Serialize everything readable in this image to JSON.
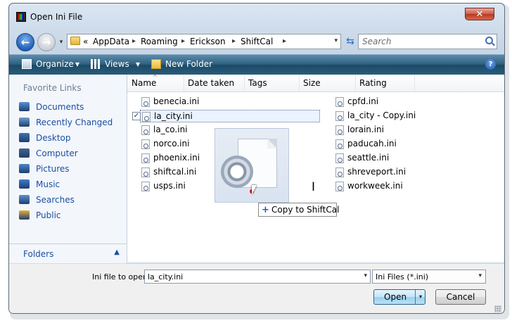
{
  "window": {
    "title": "Open Ini File",
    "close_glyph": "✕"
  },
  "nav": {
    "back_glyph": "←",
    "forward_glyph": "→",
    "history_glyph": "▾",
    "crumb_prefix": "«",
    "breadcrumbs": [
      "AppData",
      "Roaming",
      "Erickson",
      "ShiftCal"
    ],
    "crumb_sep": "▸",
    "dropdown_glyph": "▾",
    "refresh_glyph": "⇆",
    "search_placeholder": "Search"
  },
  "toolbar": {
    "organize_label": "Organize",
    "views_label": "Views",
    "new_folder_label": "New Folder",
    "dropdown_glyph": "▾",
    "help_glyph": "?"
  },
  "sidebar": {
    "heading": "Favorite Links",
    "items": [
      {
        "label": "Documents",
        "icon": "documents-icon",
        "color": "#5b8fd6"
      },
      {
        "label": "Recently Changed",
        "icon": "recently-changed-icon",
        "color": "#6d9bd3"
      },
      {
        "label": "Desktop",
        "icon": "desktop-icon",
        "color": "#3d6fb5"
      },
      {
        "label": "Computer",
        "icon": "computer-icon",
        "color": "#47628a"
      },
      {
        "label": "Pictures",
        "icon": "pictures-icon",
        "color": "#4b86cc"
      },
      {
        "label": "Music",
        "icon": "music-icon",
        "color": "#3f7ccd"
      },
      {
        "label": "Searches",
        "icon": "searches-icon",
        "color": "#5c8fd0"
      },
      {
        "label": "Public",
        "icon": "public-icon",
        "color": "#e2b13b"
      }
    ],
    "folders_label": "Folders",
    "folders_chevron": "▲"
  },
  "columns": [
    "Name",
    "Date taken",
    "Tags",
    "Size",
    "Rating"
  ],
  "sort_glyph": "^",
  "files_left": [
    "benecia.ini",
    "la_city.ini",
    "la_co.ini",
    "norco.ini",
    "phoenix.ini",
    "shiftcal.ini",
    "usps.ini"
  ],
  "files_right": [
    "cpfd.ini",
    "la_city - Copy.ini",
    "lorain.ini",
    "paducah.ini",
    "seattle.ini",
    "shreveport.ini",
    "workweek.ini"
  ],
  "selected_file": "la_city.ini",
  "check_glyph": "✓",
  "drag": {
    "plus_glyph": "+",
    "tooltip": "Copy to ShiftCal",
    "ibeam_glyph": "I"
  },
  "bottom": {
    "file_label": "Ini file to open:",
    "file_value": "la_city.ini",
    "file_type": "Ini Files (*.ini)",
    "dropdown_glyph": "▾",
    "open_label": "Open",
    "cancel_label": "Cancel"
  }
}
